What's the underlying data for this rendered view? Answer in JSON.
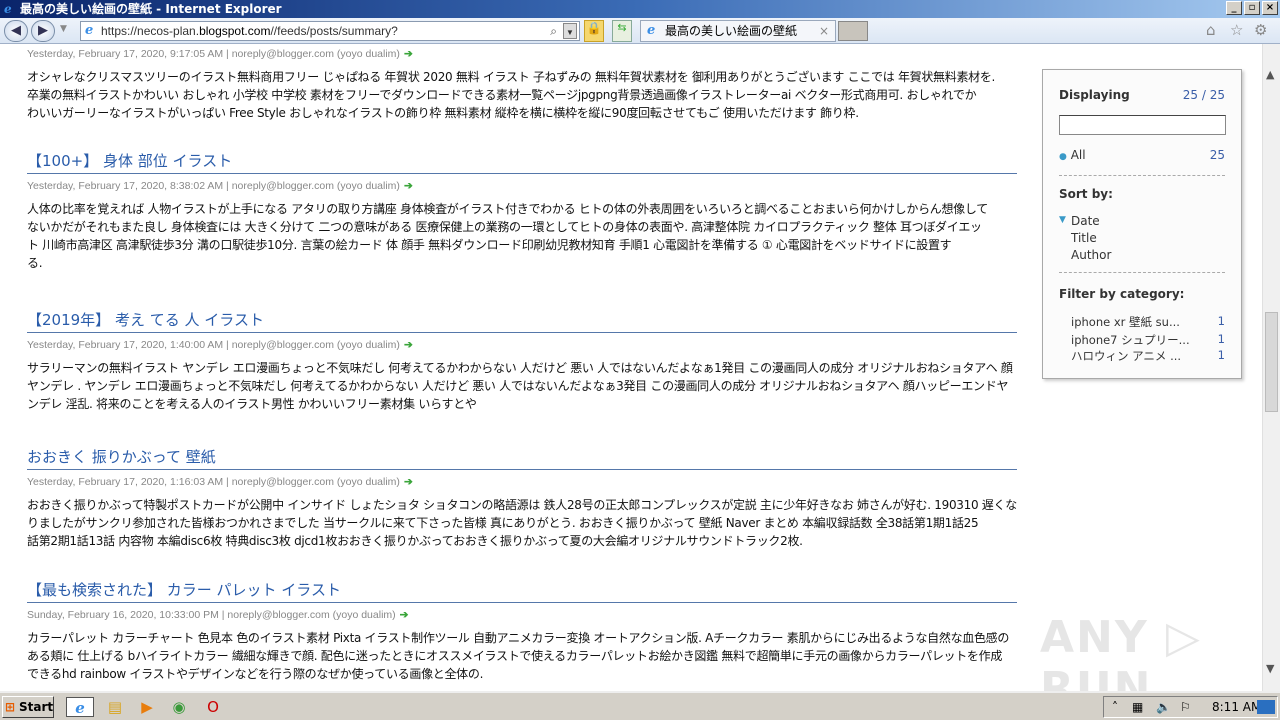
{
  "window": {
    "title": "最高の美しい絵画の壁紙 - Internet Explorer"
  },
  "browser": {
    "url_prefix": "https://necos-plan.",
    "url_domain": "blogspot.com",
    "url_suffix": "//feeds/posts/summary?",
    "tab_title": "最高の美しい絵画の壁紙",
    "tab_close": "×"
  },
  "posts": [
    {
      "title": "",
      "meta": "Yesterday, February 17, 2020, 9:17:05 AM | noreply@blogger.com (yoyo dualim)",
      "body": [
        "オシャレなクリスマスツリーのイラスト無料商用フリー じゃぱねる 年賀状 2020 無料 イラスト 子ねずみの 無料年賀状素材を 御利用ありがとうございます ここでは 年賀状無料素材を.",
        "卒業の無料イラストかわいい おしゃれ 小学校 中学校 素材をフリーでダウンロードできる素材一覧ページjpgpng背景透過画像イラストレーターai ベクター形式商用可. おしゃれでか",
        "わいいガーリーなイラストがいっぱい Free Style おしゃれなイラストの飾り枠 無料素材 縦枠を横に横枠を縦に90度回転させてもご 使用いただけます 飾り枠."
      ]
    },
    {
      "title": "【100+】 身体 部位 イラスト",
      "meta": "Yesterday, February 17, 2020, 8:38:02 AM | noreply@blogger.com (yoyo dualim)",
      "body": [
        "人体の比率を覚えれば 人物イラストが上手になる アタリの取り方講座 身体検査がイラスト付きでわかる ヒトの体の外表周囲をいろいろと調べることおまいら何かけしからん想像して",
        "ないかだがそれもまた良し 身体検査には 大きく分けて 二つの意味がある 医療保健上の業務の一環としてヒトの身体の表面や. 高津整体院 カイロプラクティック 整体 耳つぼダイエッ",
        "ト 川崎市高津区 高津駅徒歩3分 溝の口駅徒歩10分. 言葉の絵カード 体 顔手 無料ダウンロード印刷幼児教材知育 手順1 心電図計を準備する ① 心電図計をベッドサイドに設置す",
        "る."
      ]
    },
    {
      "title": "【2019年】 考え てる 人 イラスト",
      "meta": "Yesterday, February 17, 2020, 1:40:00 AM | noreply@blogger.com (yoyo dualim)",
      "body": [
        "サラリーマンの無料イラスト ヤンデレ エロ漫画ちょっと不気味だし 何考えてるかわからない 人だけど 悪い 人ではないんだよなぁ1発目 この漫画同人の成分 オリジナルおねショタアヘ 顔",
        "ヤンデレ . ヤンデレ エロ漫画ちょっと不気味だし 何考えてるかわからない 人だけど 悪い 人ではないんだよなぁ3発目 この漫画同人の成分 オリジナルおねショタアヘ 顔ハッピーエンドヤ",
        "ンデレ 淫乱. 将来のことを考える人のイラスト男性 かわいいフリー素材集 いらすとや"
      ]
    },
    {
      "title": "おおきく 振りかぶって 壁紙",
      "meta": "Yesterday, February 17, 2020, 1:16:03 AM | noreply@blogger.com (yoyo dualim)",
      "body": [
        "おおきく振りかぶって特製ポストカードが公開中 インサイド しょたショタ ショタコンの略語源は 鉄人28号の正太郎コンプレックスが定説 主に少年好きなお 姉さんが好む. 190310 遅くな",
        "りましたがサンクリ参加された皆様おつかれさまでした 当サークルに来て下さった皆様 真にありがとう. おおきく振りかぶって 壁紙 Naver まとめ 本編収録話数 全38話第1期1話25",
        "話第2期1話13話 内容物 本編disc6枚 特典disc3枚 djcd1枚おおきく振りかぶっておおきく振りかぶって夏の大会編オリジナルサウンドトラック2枚."
      ]
    },
    {
      "title": "【最も検索された】 カラー パレット イラスト",
      "meta": "Sunday, February 16, 2020, 10:33:00 PM | noreply@blogger.com (yoyo dualim)",
      "body": [
        "カラーパレット カラーチャート 色見本 色のイラスト素材 Pixta イラスト制作ツール 自動アニメカラー変換 オートアクション版. Aチークカラー 素肌からにじみ出るような自然な血色感の",
        "ある頬に 仕上げる bハイライトカラー 繊細な輝きで顔. 配色に迷ったときにオススメイラストで使えるカラーパレットお絵かき図鑑 無料で超簡単に手元の画像からカラーパレットを作成",
        "できるhd rainbow イラストやデザインなどを行う際のなぜか使っている画像と全体の."
      ]
    }
  ],
  "panel": {
    "displaying_label": "Displaying",
    "displaying_count": "25 / 25",
    "search_value": "",
    "all_label": "All",
    "all_count": "25",
    "sort_label": "Sort by:",
    "sort_options": [
      "Date",
      "Title",
      "Author"
    ],
    "sort_selected": "Date",
    "filter_label": "Filter by category:",
    "categories": [
      {
        "name": "iphone xr 壁紙 su...",
        "count": "1"
      },
      {
        "name": "iphone7 シュプリー...",
        "count": "1"
      },
      {
        "name": "ハロウィン アニメ ...",
        "count": "1"
      }
    ]
  },
  "taskbar": {
    "start_label": "Start",
    "clock": "8:11 AM"
  },
  "watermark": "ANY RUN",
  "colors": {
    "link": "#2a5caa",
    "arrow": "#3aa53a",
    "accent": "#3a5ea8"
  }
}
